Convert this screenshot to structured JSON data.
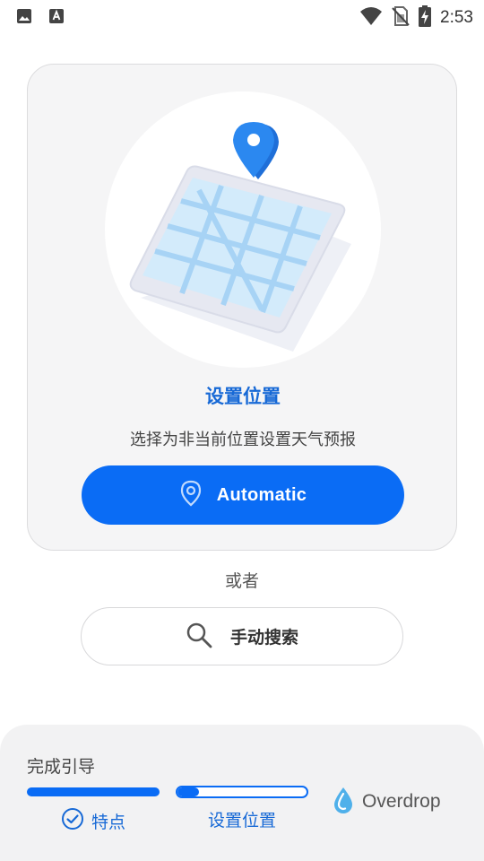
{
  "status_bar": {
    "time": "2:53",
    "left_icons": [
      "image-icon",
      "a-badge-icon"
    ],
    "right_icons": [
      "wifi-icon",
      "no-sim-icon",
      "battery-charging-icon"
    ]
  },
  "card": {
    "illustration": "phone-map-location-pin",
    "title": "设置位置",
    "subtitle": "选择为非当前位置设置天气预报",
    "automatic_button": {
      "label": "Automatic",
      "icon": "location-pin-outline-icon"
    }
  },
  "or_text": "或者",
  "search_button": {
    "label": "手动搜索",
    "icon": "search-icon"
  },
  "guide": {
    "title": "完成引导",
    "steps": [
      {
        "label": "特点",
        "progress": 1.0,
        "completed": true,
        "icon": "check-circle-icon"
      },
      {
        "label": "设置位置",
        "progress": 0.17,
        "completed": false
      }
    ],
    "brand": {
      "name": "Overdrop",
      "icon": "droplet-icon"
    }
  },
  "colors": {
    "accent": "#0a6cf5",
    "title_blue": "#1769d6",
    "card_bg": "#f5f5f6",
    "panel_bg": "#f2f2f3"
  }
}
